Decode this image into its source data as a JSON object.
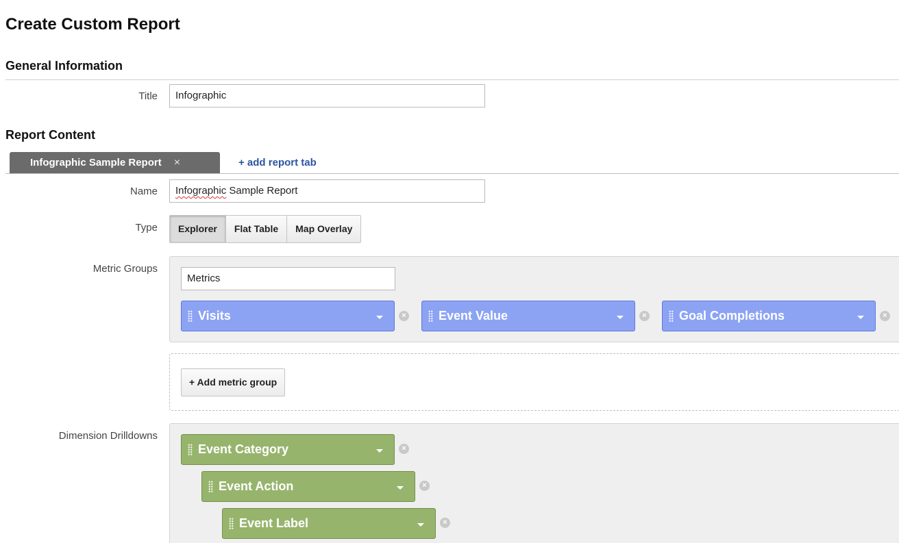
{
  "page": {
    "title": "Create Custom Report"
  },
  "general": {
    "heading": "General Information",
    "title_label": "Title",
    "title_value": "Infographic"
  },
  "content": {
    "heading": "Report Content",
    "active_tab": "Infographic Sample Report",
    "tab_close": "×",
    "add_tab": "+ add report tab",
    "name_label": "Name",
    "name_value_misspelled": "Infographic",
    "name_value_rest": " Sample Report",
    "type_label": "Type",
    "types": [
      "Explorer",
      "Flat Table",
      "Map Overlay"
    ],
    "selected_type": "Explorer"
  },
  "metric_groups": {
    "label": "Metric Groups",
    "group_name": "Metrics",
    "metrics": [
      "Visits",
      "Event Value",
      "Goal Completions"
    ],
    "add_group": "+ Add metric group"
  },
  "dimension_drilldowns": {
    "label": "Dimension Drilldowns",
    "dimensions": [
      "Event Category",
      "Event Action",
      "Event Label"
    ]
  },
  "icons": {
    "remove": "remove-circle-icon",
    "grip": "drag-handle-icon",
    "caret": "caret-down-icon"
  },
  "colors": {
    "metric_chip": "#8ca3f4",
    "dimension_chip": "#97b46d",
    "active_tab": "#6b6b6b",
    "link": "#2a55a0"
  }
}
